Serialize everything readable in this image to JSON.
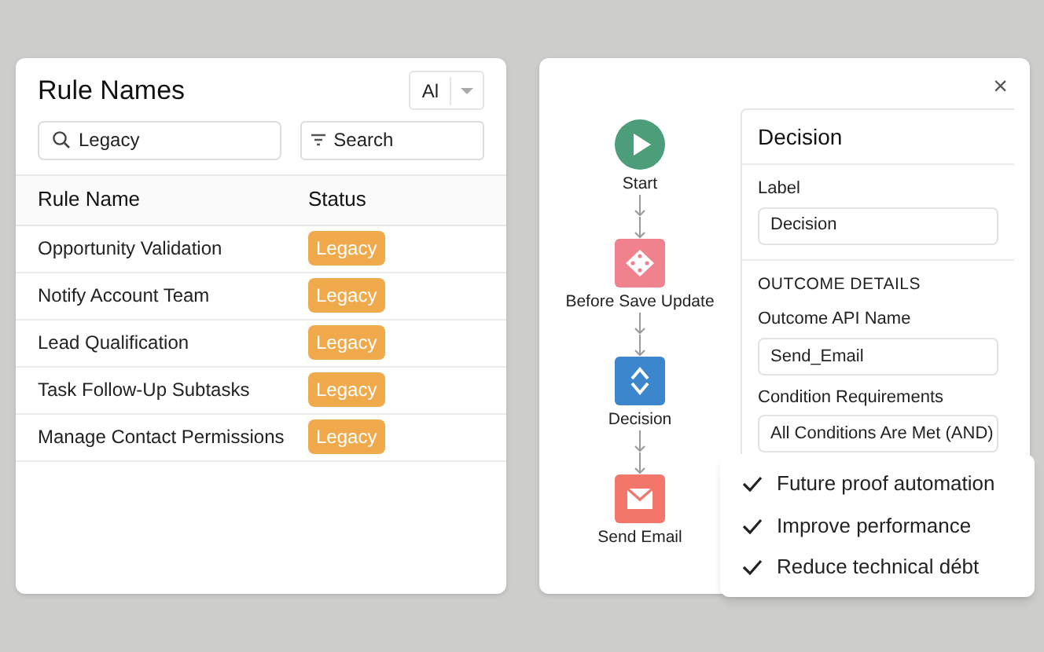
{
  "rules_panel": {
    "title": "Rule Names",
    "filter_dropdown": "Al",
    "search": {
      "value": "Legacy"
    },
    "filter_button": "Search",
    "columns": [
      "Rule Name",
      "Status"
    ],
    "rows": [
      {
        "name": "Opportunity Validation",
        "status": "Legacy"
      },
      {
        "name": "Notify Account Team",
        "status": "Legacy"
      },
      {
        "name": "Lead Qualification",
        "status": "Legacy"
      },
      {
        "name": "Task Follow-Up Subtasks",
        "status": "Legacy"
      },
      {
        "name": "Manage Contact Permissions",
        "status": "Legacy"
      }
    ]
  },
  "flow_panel": {
    "close": "×",
    "nodes": [
      {
        "kind": "start",
        "label": "Start"
      },
      {
        "kind": "update",
        "label": "Before Save Update"
      },
      {
        "kind": "decision",
        "label": "Decision"
      },
      {
        "kind": "email",
        "label": "Send Email"
      }
    ],
    "details": {
      "title": "Decision",
      "label_field": {
        "label": "Label",
        "value": "Decision"
      },
      "section": "OUTCOME DETAILS",
      "api_name_field": {
        "label": "Outcome API Name",
        "value": "Send_Email"
      },
      "condition_field": {
        "label": "Condition Requirements",
        "value": "All Conditions Are Met (AND)"
      }
    }
  },
  "benefits": [
    {
      "text": "Future proof automation",
      "checked": true
    },
    {
      "text": "Improve performance",
      "checked": true
    },
    {
      "text": "Reduce technical débt",
      "checked": true
    }
  ]
}
